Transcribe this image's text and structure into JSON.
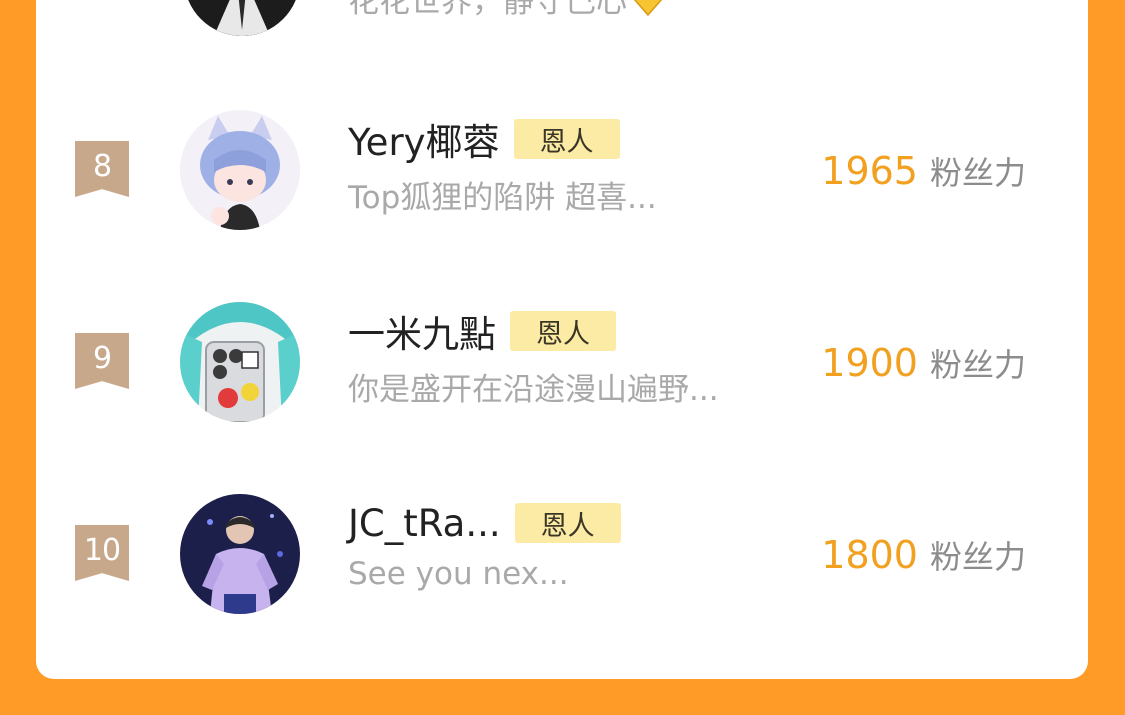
{
  "colors": {
    "background": "#FF9B26",
    "card": "#FFFFFF",
    "rank_flag": "#C7A88B",
    "badge_bg": "#FBEBA5",
    "score": "#F2A020",
    "muted_text": "#A9A9A9"
  },
  "previous_entry": {
    "signature": "花花世界，静守己心",
    "icon": "yellow-heart-icon"
  },
  "ranking": [
    {
      "rank": "8",
      "name": "Yery椰蓉",
      "badge": "恩人",
      "signature": "Top狐狸的陷阱 超喜...",
      "score": "1965",
      "score_unit": "粉丝力"
    },
    {
      "rank": "9",
      "name": "一米九點",
      "badge": "恩人",
      "signature": "你是盛开在沿途漫山遍野...",
      "score": "1900",
      "score_unit": "粉丝力"
    },
    {
      "rank": "10",
      "name": "JC_tRa...",
      "badge": "恩人",
      "signature": "See you nex...",
      "score": "1800",
      "score_unit": "粉丝力"
    }
  ]
}
